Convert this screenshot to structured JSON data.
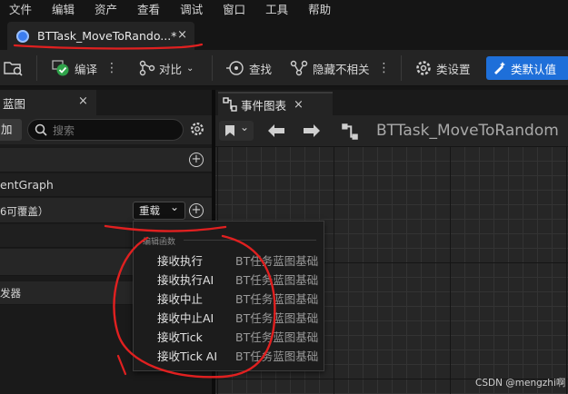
{
  "menubar": {
    "items": [
      "文件",
      "编辑",
      "资产",
      "查看",
      "调试",
      "窗口",
      "工具",
      "帮助"
    ]
  },
  "doc_tab": {
    "title": "BTTask_MoveToRando...*",
    "close": "×"
  },
  "toolbar": {
    "compile_label": "编译",
    "diff_label": "对比",
    "find_label": "查找",
    "hide_unrelated_label": "隐藏不相关",
    "class_settings_label": "类设置",
    "class_defaults_label": "类默认值"
  },
  "blueprint_panel": {
    "tab_label": "蓝图",
    "close": "×",
    "add_label": "加",
    "search_placeholder": "搜索",
    "graph_row_label": "entGraph",
    "functions_row_label": "6可覆盖）",
    "override_label": "重载",
    "dispatcher_row_label": "发器"
  },
  "graph_panel": {
    "tab_label": "事件图表",
    "close": "×",
    "title": "BTTask_MoveToRandom"
  },
  "override_menu": {
    "header": "编辑函数",
    "items": [
      {
        "name": "接收执行",
        "source": "BT任务蓝图基础"
      },
      {
        "name": "接收执行AI",
        "source": "BT任务蓝图基础"
      },
      {
        "name": "接收中止",
        "source": "BT任务蓝图基础"
      },
      {
        "name": "接收中止AI",
        "source": "BT任务蓝图基础"
      },
      {
        "name": "接收Tick",
        "source": "BT任务蓝图基础"
      },
      {
        "name": "接收Tick AI",
        "source": "BT任务蓝图基础"
      }
    ]
  },
  "watermark": "CSDN @mengzhi啊",
  "colors": {
    "accent": "#1e6fd9",
    "annotation": "#e02020"
  }
}
